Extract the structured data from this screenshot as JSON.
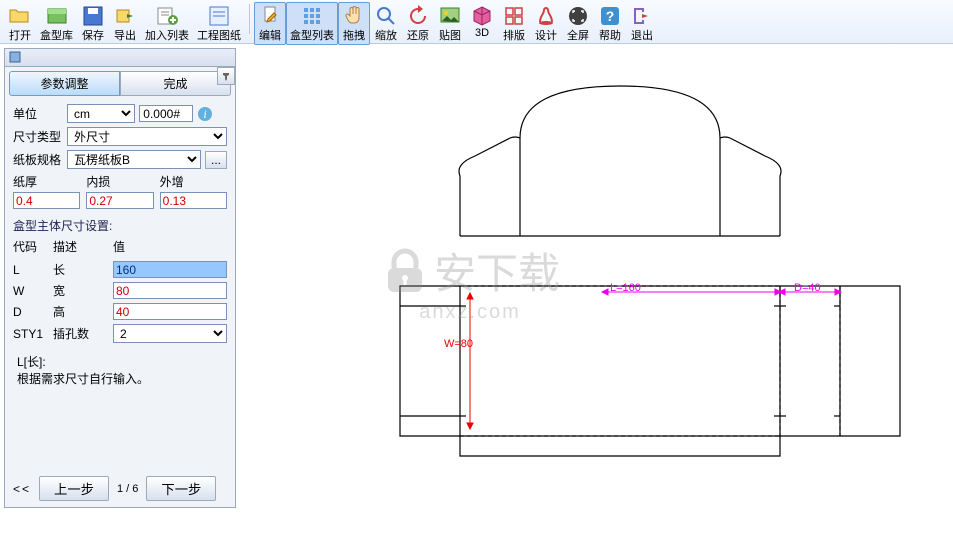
{
  "toolbar": [
    {
      "id": "open",
      "label": "打开"
    },
    {
      "id": "lib",
      "label": "盒型库"
    },
    {
      "id": "save",
      "label": "保存"
    },
    {
      "id": "export",
      "label": "导出"
    },
    {
      "id": "addlist",
      "label": "加入列表"
    },
    {
      "id": "eng",
      "label": "工程图纸"
    },
    {
      "sep": true
    },
    {
      "id": "edit",
      "label": "编辑",
      "active": true
    },
    {
      "id": "boxlist",
      "label": "盒型列表",
      "active": true
    },
    {
      "id": "drag",
      "label": "拖拽",
      "active": true
    },
    {
      "id": "zoom",
      "label": "缩放"
    },
    {
      "id": "restore",
      "label": "还原"
    },
    {
      "id": "paste",
      "label": "贴图"
    },
    {
      "id": "3d",
      "label": "3D"
    },
    {
      "id": "layout",
      "label": "排版"
    },
    {
      "id": "design",
      "label": "设计"
    },
    {
      "id": "full",
      "label": "全屏"
    },
    {
      "id": "help",
      "label": "帮助"
    },
    {
      "id": "exit",
      "label": "退出"
    }
  ],
  "tabs": {
    "param": "参数调整",
    "done": "完成"
  },
  "unit": {
    "label": "单位",
    "value": "cm",
    "format": "0.000#"
  },
  "sizeType": {
    "label": "尺寸类型",
    "value": "外尺寸"
  },
  "board": {
    "label": "纸板规格",
    "value": "瓦楞纸板B"
  },
  "thickness": {
    "thick_lbl": "纸厚",
    "thick_val": "0.4",
    "inner_lbl": "内损",
    "inner_val": "0.27",
    "outer_lbl": "外增",
    "outer_val": "0.13"
  },
  "mainSize": {
    "title": "盒型主体尺寸设置:",
    "headers": {
      "code": "代码",
      "desc": "描述",
      "val": "值"
    }
  },
  "rows": [
    {
      "code": "L",
      "desc": "长",
      "val": "160",
      "hl": true,
      "type": "input"
    },
    {
      "code": "W",
      "desc": "宽",
      "val": "80",
      "type": "input"
    },
    {
      "code": "D",
      "desc": "高",
      "val": "40",
      "type": "input"
    },
    {
      "code": "STY1",
      "desc": "插孔数",
      "val": "2",
      "type": "select"
    }
  ],
  "explain": {
    "title": "L[长]:",
    "text": "根据需求尺寸自行输入。"
  },
  "nav": {
    "prev": "上一步",
    "page": "1 / 6",
    "next": "下一步"
  },
  "dims": {
    "w": "W=80",
    "l": "L=160",
    "d": "D=40"
  },
  "watermark": {
    "big": "安下载",
    "small": "anxz.com"
  }
}
